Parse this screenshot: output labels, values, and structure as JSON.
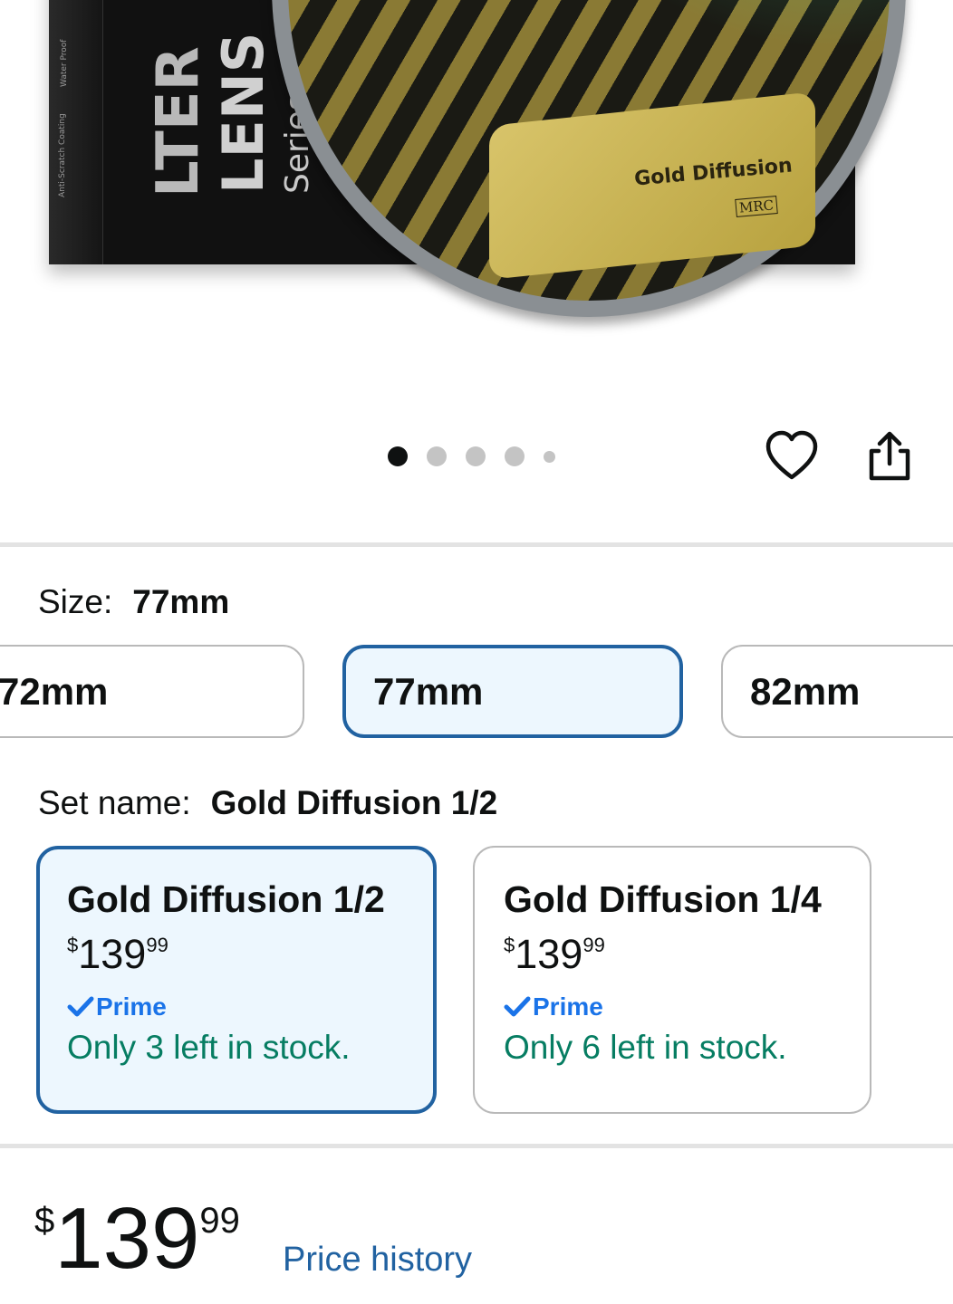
{
  "product_image": {
    "box_text_brand": "LENS",
    "box_text_type": "LTER",
    "box_text_series": "Series",
    "box_badge_1": "Water Proof",
    "box_badge_2": "Anti-Scratch Coating",
    "card_label": "Gold Diffusion",
    "card_sub": "MRC"
  },
  "carousel": {
    "dot_count": 5,
    "active_index": 0
  },
  "actions": {
    "favorite_icon": "heart-icon",
    "share_icon": "share-icon"
  },
  "size": {
    "label": "Size:",
    "selected": "77mm",
    "options": [
      "72mm",
      "77mm",
      "82mm"
    ]
  },
  "set_name": {
    "label": "Set name:",
    "selected": "Gold Diffusion 1/2",
    "options": [
      {
        "title": "Gold Diffusion 1/2",
        "currency": "$",
        "price_whole": "139",
        "price_frac": "99",
        "prime": "Prime",
        "stock": "Only 3 left in stock."
      },
      {
        "title": "Gold Diffusion 1/4",
        "currency": "$",
        "price_whole": "139",
        "price_frac": "99",
        "prime": "Prime",
        "stock": "Only 6 left in stock."
      }
    ]
  },
  "price": {
    "currency": "$",
    "whole": "139",
    "fraction": "99",
    "history_link": "Price history"
  },
  "colors": {
    "selected_border": "#2162a1",
    "selected_bg": "#edf7fe",
    "prime_blue": "#1a73e8",
    "stock_green": "#067d62",
    "link_blue": "#2162a1"
  }
}
